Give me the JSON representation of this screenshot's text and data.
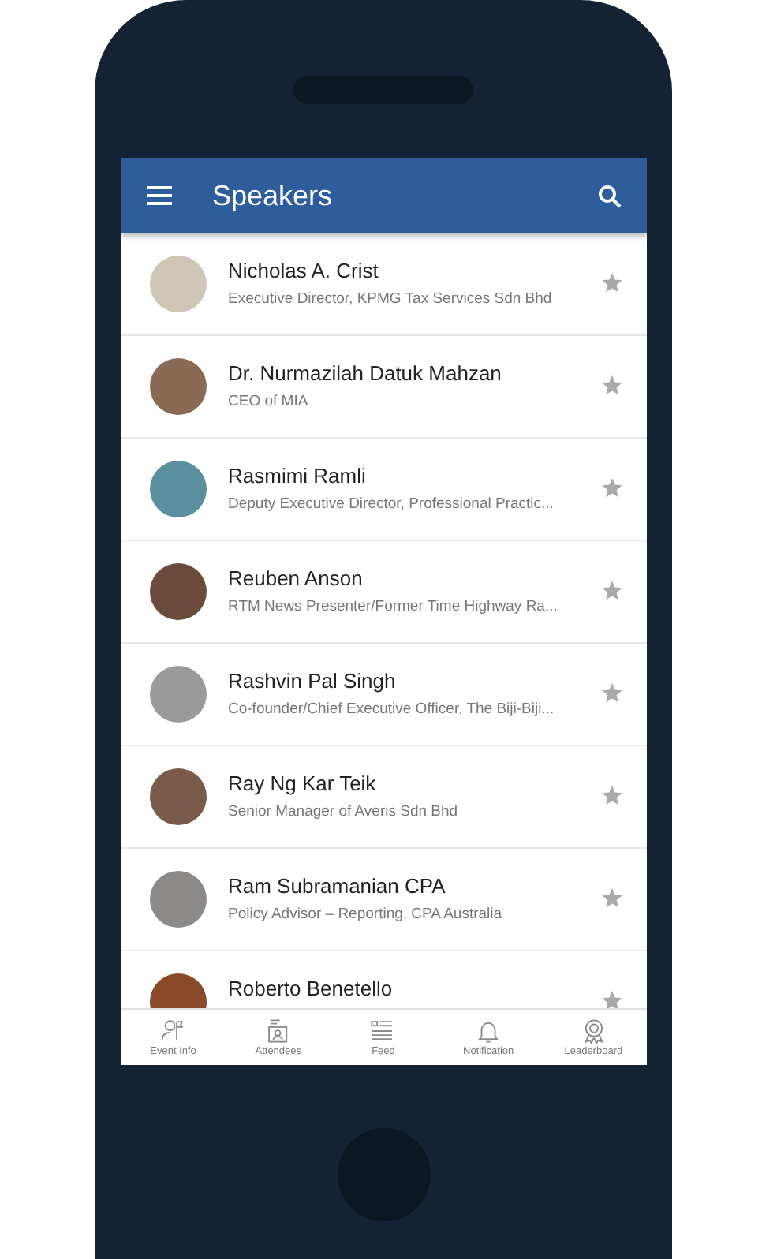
{
  "header": {
    "title": "Speakers"
  },
  "speakers": [
    {
      "name": "Nicholas A. Crist",
      "role": "Executive Director, KPMG Tax Services Sdn Bhd",
      "starred": false
    },
    {
      "name": "Dr. Nurmazilah Datuk Mahzan",
      "role": "CEO of MIA",
      "starred": false
    },
    {
      "name": "Rasmimi Ramli",
      "role": "Deputy Executive Director, Professional Practic...",
      "starred": false
    },
    {
      "name": "Reuben Anson",
      "role": "RTM News Presenter/Former Time Highway Ra...",
      "starred": false
    },
    {
      "name": "Rashvin Pal Singh",
      "role": "Co-founder/Chief Executive Officer, The Biji-Biji...",
      "starred": false
    },
    {
      "name": "Ray Ng Kar Teik",
      "role": "Senior Manager of Averis Sdn Bhd",
      "starred": false
    },
    {
      "name": "Ram Subramanian CPA",
      "role": "Policy Advisor – Reporting, CPA Australia",
      "starred": false
    },
    {
      "name": "Roberto Benetello",
      "starred": false
    }
  ],
  "bottom_nav": [
    {
      "kind": "event",
      "label": "Event Info"
    },
    {
      "kind": "attendees",
      "label": "Attendees"
    },
    {
      "kind": "feed",
      "label": "Feed"
    },
    {
      "kind": "bell",
      "label": "Notification"
    },
    {
      "kind": "badge",
      "label": "Leaderboard"
    }
  ]
}
